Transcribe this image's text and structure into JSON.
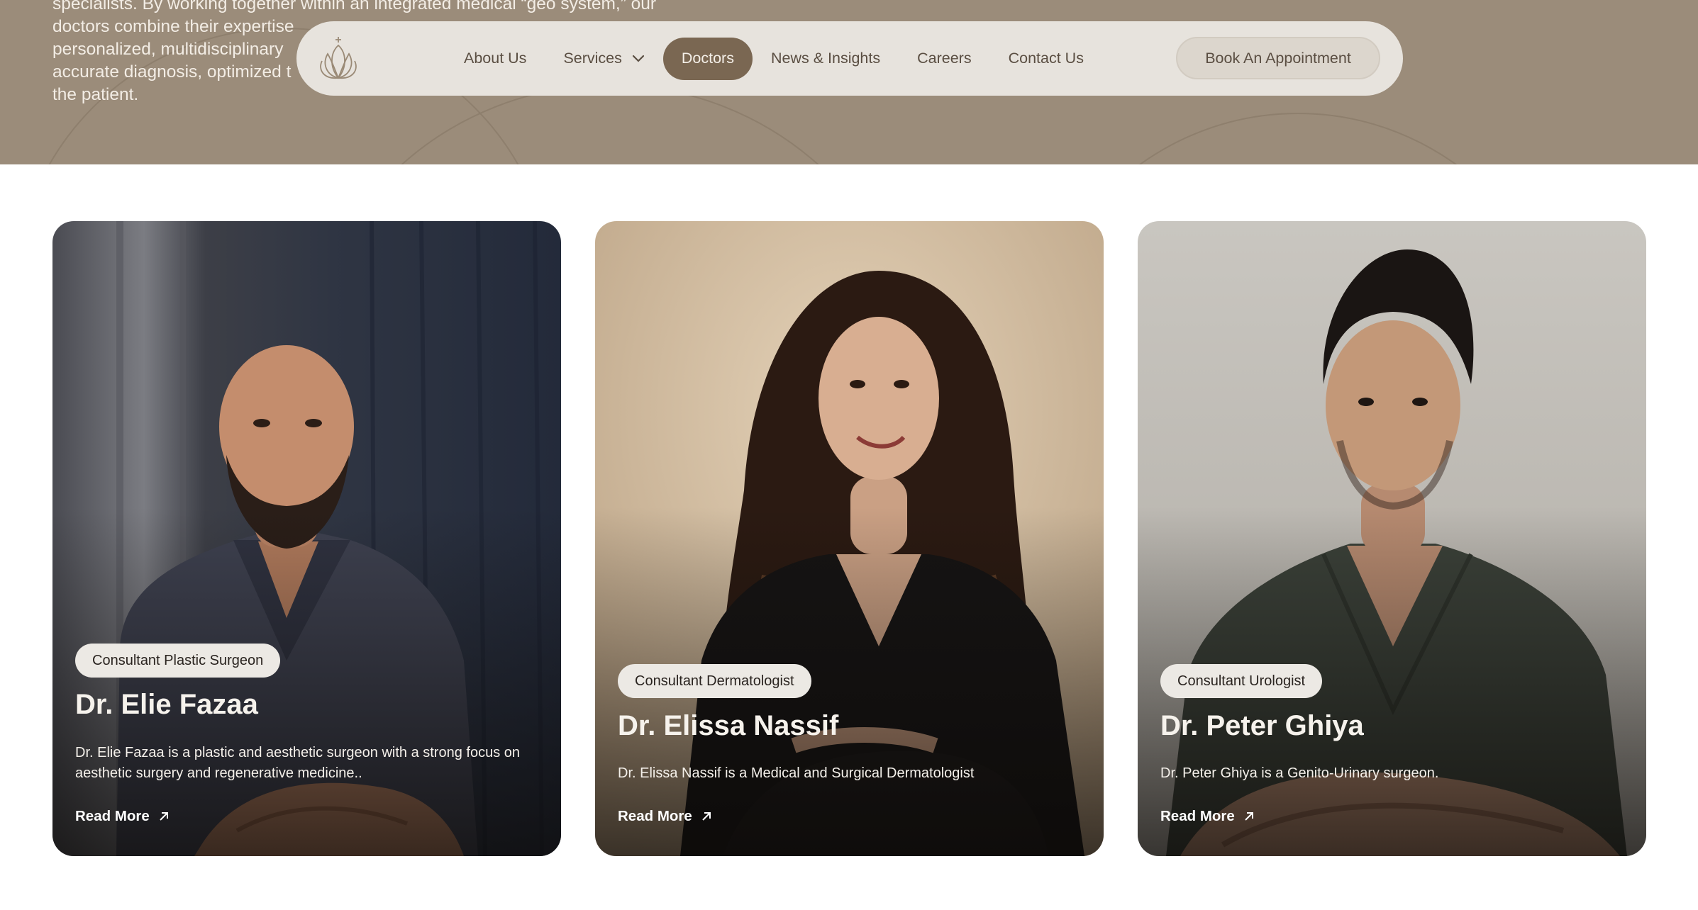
{
  "hero": {
    "lines": [
      "specialists. By working together within an integrated medical “geo system,” our",
      "doctors combine their expertise",
      "personalized, multidisciplinary",
      "accurate diagnosis, optimized t",
      "the patient."
    ]
  },
  "nav": {
    "logo_icon": "lotus-logo-icon",
    "links": [
      {
        "label": "About Us"
      },
      {
        "label": "Services"
      },
      {
        "label": "Doctors"
      },
      {
        "label": "News & Insights"
      },
      {
        "label": "Careers"
      },
      {
        "label": "Contact Us"
      }
    ],
    "active": "Doctors",
    "cta_label": "Book An Appointment"
  },
  "doctors": [
    {
      "specialty": "Consultant Plastic Surgeon",
      "name": "Dr. Elie Fazaa",
      "description": "Dr. Elie Fazaa is a plastic and aesthetic surgeon with a strong focus on aesthetic surgery and regenerative medicine..",
      "read_more": "Read More",
      "scrub_text": "Dr Elie Fa\nPlastic Su"
    },
    {
      "specialty": "Consultant Dermatologist",
      "name": "Dr. Elissa Nassif",
      "description": "Dr. Elissa Nassif is a Medical and Surgical Dermatologist",
      "read_more": "Read More",
      "scrub_text": "Dr. Elissa Nassif\nDermatologist"
    },
    {
      "specialty": "Consultant Urologist",
      "name": "Dr. Peter Ghiya",
      "description": "Dr. Peter Ghiya is a Genito-Urinary surgeon.",
      "read_more": "Read More",
      "scrub_text": "Dr. Pet"
    }
  ],
  "colors": {
    "hero_bg": "#9b8c7a",
    "nav_bg": "#e7e3dd",
    "active_pill": "#7a6752",
    "text_brown": "#5a4e42"
  }
}
